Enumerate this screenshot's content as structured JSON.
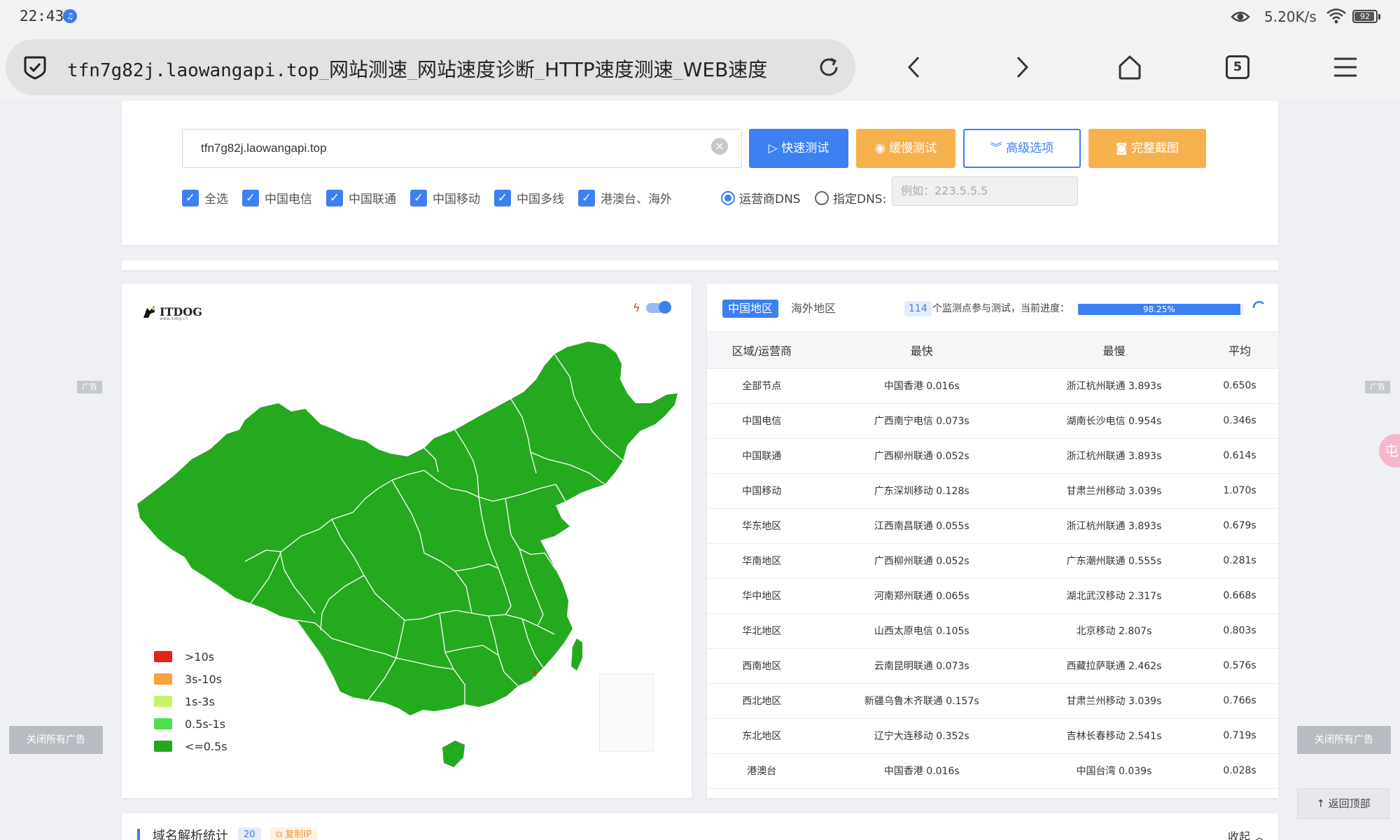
{
  "status_bar": {
    "time": "22:43",
    "network_speed": "5.20K/s",
    "battery": "92"
  },
  "browser": {
    "url_host": "tfn7g82j.laowangapi.top",
    "url_title": "_网站测速_网站速度诊断_HTTP速度测速_WEB速度",
    "tab_count": "5"
  },
  "test_form": {
    "url_value": "tfn7g82j.laowangapi.top",
    "buttons": {
      "quick": "快速测试",
      "slow": "缓慢测试",
      "advanced": "高级选项",
      "screenshot": "完整截图"
    },
    "checkboxes": [
      "全选",
      "中国电信",
      "中国联通",
      "中国移动",
      "中国多线",
      "港澳台、海外"
    ],
    "dns_options": {
      "isp": "运营商DNS",
      "custom": "指定DNS:",
      "custom_placeholder": "例如：223.5.5.5"
    }
  },
  "map": {
    "logo": "ITDOG",
    "logo_sub": "www.itdog.cn",
    "legend": [
      {
        "label": ">10s",
        "color": "#e2231a"
      },
      {
        "label": "3s-10s",
        "color": "#f7a23a"
      },
      {
        "label": "1s-3s",
        "color": "#c7f26a"
      },
      {
        "label": "0.5s-1s",
        "color": "#4ee04a"
      },
      {
        "label": "<=0.5s",
        "color": "#22a81e"
      }
    ],
    "fill_color": "#25a91f"
  },
  "results": {
    "tab_active": "中国地区",
    "tab_other": "海外地区",
    "node_count": "114",
    "node_text": "个监测点参与测试，当前进度：",
    "progress_label": "98.25%",
    "progress": 98.25,
    "columns": [
      "区域/运营商",
      "最快",
      "最慢",
      "平均"
    ],
    "rows": [
      [
        "全部节点",
        "中国香港 0.016s",
        "浙江杭州联通 3.893s",
        "0.650s"
      ],
      [
        "中国电信",
        "广西南宁电信 0.073s",
        "湖南长沙电信 0.954s",
        "0.346s"
      ],
      [
        "中国联通",
        "广西柳州联通 0.052s",
        "浙江杭州联通 3.893s",
        "0.614s"
      ],
      [
        "中国移动",
        "广东深圳移动 0.128s",
        "甘肃兰州移动 3.039s",
        "1.070s"
      ],
      [
        "华东地区",
        "江西南昌联通 0.055s",
        "浙江杭州联通 3.893s",
        "0.679s"
      ],
      [
        "华南地区",
        "广西柳州联通 0.052s",
        "广东潮州联通 0.555s",
        "0.281s"
      ],
      [
        "华中地区",
        "河南郑州联通 0.065s",
        "湖北武汉移动 2.317s",
        "0.668s"
      ],
      [
        "华北地区",
        "山西太原电信 0.105s",
        "北京移动 2.807s",
        "0.803s"
      ],
      [
        "西南地区",
        "云南昆明联通 0.073s",
        "西藏拉萨联通 2.462s",
        "0.576s"
      ],
      [
        "西北地区",
        "新疆乌鲁木齐联通 0.157s",
        "甘肃兰州移动 3.039s",
        "0.766s"
      ],
      [
        "东北地区",
        "辽宁大连移动 0.352s",
        "吉林长春移动 2.541s",
        "0.719s"
      ],
      [
        "港澳台",
        "中国香港 0.016s",
        "中国台湾 0.039s",
        "0.028s"
      ]
    ]
  },
  "dns_section": {
    "title": "域名解析统计",
    "count": "20",
    "copy_ip": "复制IP",
    "collapse": "收起"
  },
  "side": {
    "ad_label": "广告",
    "close_ads": "关闭所有广告",
    "back_top": "返回顶部",
    "bubble": "屯"
  }
}
